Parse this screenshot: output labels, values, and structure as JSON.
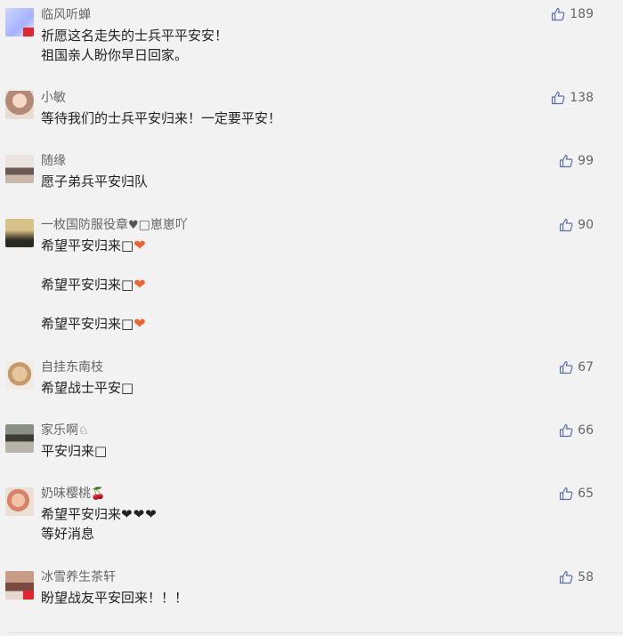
{
  "comments": [
    {
      "name": "临风听蝉",
      "likes": "189",
      "lines": [
        "祈愿这名走失的士兵平平安安！",
        "祖国亲人盼你早日回家。"
      ]
    },
    {
      "name": "小敏",
      "likes": "138",
      "lines": [
        "等待我们的士兵平安归来！一定要平安！"
      ]
    },
    {
      "name": "随缘",
      "likes": "99",
      "lines": [
        "愿子弟兵平安归队"
      ]
    },
    {
      "name": "一枚国防服役章",
      "name_suffix": "□崽崽吖",
      "likes": "90",
      "lines": [
        "希望平安归来□",
        "希望平安归来□",
        "希望平安归来□"
      ]
    },
    {
      "name": "自挂东南枝",
      "likes": "67",
      "lines": [
        "希望战士平安□"
      ]
    },
    {
      "name": "家乐啊",
      "likes": "66",
      "lines": [
        "平安归来□"
      ]
    },
    {
      "name": "奶味樱桃",
      "likes": "65",
      "lines": [
        "希望平安归来",
        "等好消息"
      ]
    },
    {
      "name": "冰雪养生茶轩",
      "likes": "58",
      "lines": [
        "盼望战友平安回来！！！"
      ]
    }
  ],
  "icons": {
    "like": "thumbs-up-icon",
    "heart": "orange-heart",
    "black_hearts": "black-heart ×3"
  },
  "colors": {
    "background": "#f2f2f2",
    "like_icon": "#5b6fa8",
    "heart": "#f2622e"
  }
}
